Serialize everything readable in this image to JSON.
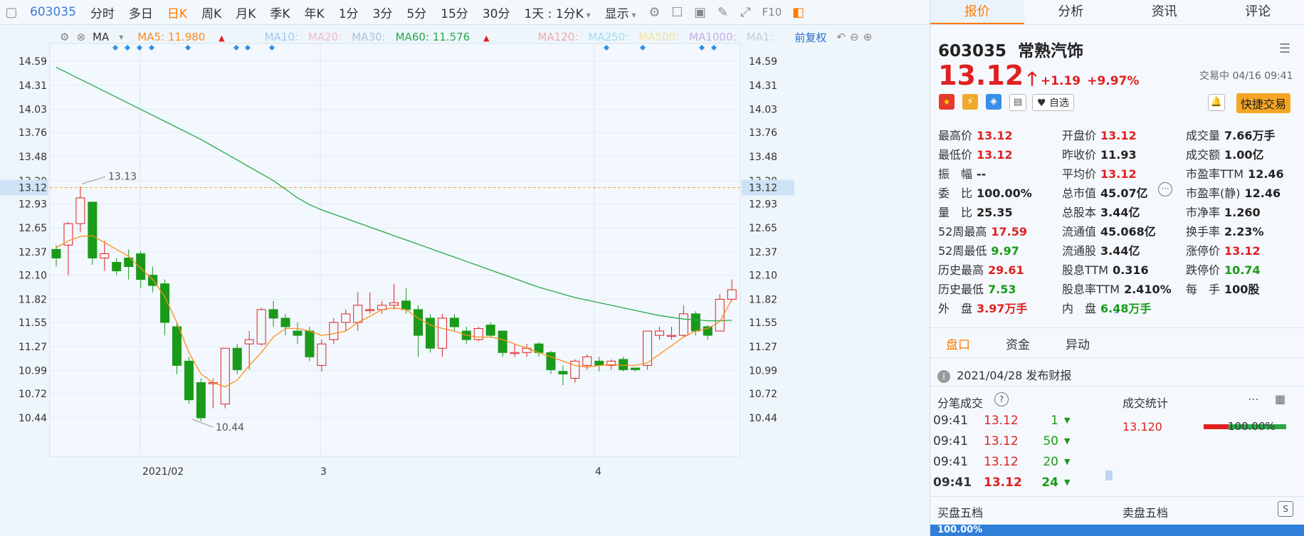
{
  "toolbar": {
    "code": "603035",
    "items": [
      "分时",
      "多日",
      "日K",
      "周K",
      "月K",
      "季K",
      "年K",
      "1分",
      "3分",
      "5分",
      "15分",
      "30分"
    ],
    "active": "日K",
    "period_select": "1天 : 1分K",
    "display": "显示",
    "f10": "F10"
  },
  "ma": {
    "label": "MA",
    "ma5": "MA5: 11.980",
    "ma10": "MA10:",
    "ma20": "MA20:",
    "ma30": "MA30:",
    "ma60": "MA60: 11.576",
    "ma120": "MA120:",
    "ma250": "MA250:",
    "ma500": "MA500:",
    "ma1000": "MA1000:",
    "ma1": "MA1:",
    "fq": "前复权"
  },
  "chart_data": {
    "type": "candlestick",
    "y_ticks": [
      "14.59",
      "14.31",
      "14.03",
      "13.76",
      "13.48",
      "13.20",
      "12.93",
      "12.65",
      "12.37",
      "12.10",
      "11.82",
      "11.55",
      "11.27",
      "10.99",
      "10.72",
      "10.44"
    ],
    "x_labels": [
      "2021/02",
      "3",
      "4"
    ],
    "current_price": "13.12",
    "high_label": "13.13",
    "low_label": "10.44",
    "candles": [
      [
        12.4,
        12.3,
        12.45,
        12.2
      ],
      [
        12.45,
        12.7,
        12.72,
        12.1
      ],
      [
        12.7,
        13.0,
        13.13,
        12.6
      ],
      [
        12.95,
        12.3,
        12.95,
        12.22
      ],
      [
        12.3,
        12.35,
        12.5,
        12.15
      ],
      [
        12.25,
        12.15,
        12.3,
        12.1
      ],
      [
        12.3,
        12.2,
        12.4,
        12.05
      ],
      [
        12.35,
        12.05,
        12.38,
        11.95
      ],
      [
        12.1,
        11.98,
        12.2,
        11.9
      ],
      [
        12.0,
        11.55,
        12.05,
        11.4
      ],
      [
        11.5,
        11.05,
        11.55,
        10.95
      ],
      [
        11.1,
        10.65,
        11.15,
        10.6
      ],
      [
        10.85,
        10.44,
        10.9,
        10.4
      ],
      [
        10.85,
        10.85,
        10.9,
        10.55
      ],
      [
        10.6,
        11.25,
        11.25,
        10.55
      ],
      [
        11.25,
        11.0,
        11.3,
        10.95
      ],
      [
        11.3,
        11.35,
        11.45,
        11.0
      ],
      [
        11.3,
        11.7,
        11.72,
        11.28
      ],
      [
        11.7,
        11.6,
        11.8,
        11.5
      ],
      [
        11.6,
        11.5,
        11.65,
        11.4
      ],
      [
        11.45,
        11.4,
        11.55,
        11.3
      ],
      [
        11.45,
        11.15,
        11.5,
        11.1
      ],
      [
        11.05,
        11.3,
        11.35,
        10.98
      ],
      [
        11.35,
        11.55,
        11.6,
        11.3
      ],
      [
        11.55,
        11.65,
        11.7,
        11.45
      ],
      [
        11.55,
        11.75,
        11.9,
        11.45
      ],
      [
        11.7,
        11.7,
        11.9,
        11.65
      ],
      [
        11.7,
        11.75,
        11.8,
        11.65
      ],
      [
        11.75,
        11.78,
        12.0,
        11.7
      ],
      [
        11.8,
        11.7,
        11.95,
        11.65
      ],
      [
        11.7,
        11.4,
        11.75,
        11.15
      ],
      [
        11.6,
        11.25,
        11.65,
        11.2
      ],
      [
        11.25,
        11.6,
        11.65,
        11.15
      ],
      [
        11.6,
        11.5,
        11.65,
        11.45
      ],
      [
        11.45,
        11.35,
        11.5,
        11.3
      ],
      [
        11.35,
        11.48,
        11.5,
        11.33
      ],
      [
        11.52,
        11.4,
        11.55,
        11.38
      ],
      [
        11.45,
        11.2,
        11.45,
        11.15
      ],
      [
        11.2,
        11.2,
        11.3,
        11.15
      ],
      [
        11.2,
        11.25,
        11.3,
        11.15
      ],
      [
        11.3,
        11.2,
        11.32,
        11.15
      ],
      [
        11.2,
        11.0,
        11.22,
        10.95
      ],
      [
        10.98,
        10.95,
        11.05,
        10.82
      ],
      [
        10.9,
        11.1,
        11.12,
        10.85
      ],
      [
        11.05,
        11.15,
        11.18,
        11.0
      ],
      [
        11.1,
        11.05,
        11.15,
        10.98
      ],
      [
        11.05,
        11.1,
        11.12,
        11.0
      ],
      [
        11.12,
        11.0,
        11.15,
        10.98
      ],
      [
        11.02,
        11.0,
        11.02,
        10.98
      ],
      [
        11.05,
        11.45,
        11.45,
        11.0
      ],
      [
        11.4,
        11.45,
        11.5,
        11.35
      ],
      [
        11.4,
        11.4,
        11.5,
        11.35
      ],
      [
        11.4,
        11.65,
        11.75,
        11.38
      ],
      [
        11.65,
        11.45,
        11.68,
        11.4
      ],
      [
        11.5,
        11.4,
        11.52,
        11.35
      ],
      [
        11.45,
        11.82,
        11.88,
        11.45
      ],
      [
        11.82,
        11.93,
        12.05,
        11.8
      ]
    ],
    "ma5": [
      12.42,
      12.5,
      12.55,
      12.56,
      12.48,
      12.4,
      12.32,
      12.18,
      12.05,
      11.85,
      11.55,
      11.2,
      10.95,
      10.85,
      10.8,
      10.88,
      11.05,
      11.2,
      11.38,
      11.48,
      11.48,
      11.45,
      11.4,
      11.42,
      11.45,
      11.55,
      11.62,
      11.7,
      11.72,
      11.7,
      11.6,
      11.52,
      11.48,
      11.45,
      11.4,
      11.38,
      11.38,
      11.35,
      11.3,
      11.25,
      11.2,
      11.15,
      11.1,
      11.05,
      11.03,
      11.05,
      11.06,
      11.05,
      11.05,
      11.08,
      11.18,
      11.28,
      11.38,
      11.45,
      11.48,
      11.56,
      11.82
    ],
    "ma60": [
      14.52,
      14.45,
      14.38,
      14.31,
      14.24,
      14.17,
      14.1,
      14.03,
      13.96,
      13.89,
      13.82,
      13.75,
      13.68,
      13.6,
      13.52,
      13.44,
      13.36,
      13.28,
      13.2,
      13.1,
      13.0,
      12.92,
      12.86,
      12.81,
      12.76,
      12.71,
      12.66,
      12.61,
      12.56,
      12.51,
      12.46,
      12.41,
      12.36,
      12.31,
      12.26,
      12.21,
      12.16,
      12.11,
      12.06,
      12.01,
      11.96,
      11.92,
      11.88,
      11.84,
      11.81,
      11.78,
      11.75,
      11.72,
      11.69,
      11.66,
      11.63,
      11.61,
      11.59,
      11.58,
      11.57,
      11.57,
      11.576
    ]
  },
  "quote": {
    "code": "603035",
    "name": "常熟汽饰",
    "price": "13.12",
    "change": "+1.19",
    "change_pct": "+9.97%",
    "status": "交易中 04/16 09:41",
    "zixuan": "自选",
    "quick_trade": "快捷交易",
    "fields": [
      [
        {
          "l": "最高价",
          "v": "13.12",
          "c": "red"
        },
        {
          "l": "开盘价",
          "v": "13.12",
          "c": "red"
        },
        {
          "l": "成交量",
          "v": "7.66万手",
          "c": "dark"
        }
      ],
      [
        {
          "l": "最低价",
          "v": "13.12",
          "c": "red"
        },
        {
          "l": "昨收价",
          "v": "11.93",
          "c": "dark"
        },
        {
          "l": "成交额",
          "v": "1.00亿",
          "c": "dark"
        }
      ],
      [
        {
          "l": "振　幅",
          "v": "--",
          "c": "dark"
        },
        {
          "l": "平均价",
          "v": "13.12",
          "c": "red"
        },
        {
          "l": "市盈率TTM",
          "v": "12.46",
          "c": "dark"
        }
      ],
      [
        {
          "l": "委　比",
          "v": "100.00%",
          "c": "dark"
        },
        {
          "l": "总市值",
          "v": "45.07亿",
          "c": "dark"
        },
        {
          "l": "市盈率(静)",
          "v": "12.46",
          "c": "dark"
        }
      ],
      [
        {
          "l": "量　比",
          "v": "25.35",
          "c": "dark"
        },
        {
          "l": "总股本",
          "v": "3.44亿",
          "c": "dark"
        },
        {
          "l": "市净率",
          "v": "1.260",
          "c": "dark"
        }
      ],
      [
        {
          "l": "52周最高",
          "v": "17.59",
          "c": "red"
        },
        {
          "l": "流通值",
          "v": "45.068亿",
          "c": "dark"
        },
        {
          "l": "换手率",
          "v": "2.23%",
          "c": "dark"
        }
      ],
      [
        {
          "l": "52周最低",
          "v": "9.97",
          "c": "green"
        },
        {
          "l": "流通股",
          "v": "3.44亿",
          "c": "dark"
        },
        {
          "l": "涨停价",
          "v": "13.12",
          "c": "red"
        }
      ],
      [
        {
          "l": "历史最高",
          "v": "29.61",
          "c": "red"
        },
        {
          "l": "股息TTM",
          "v": "0.316",
          "c": "dark"
        },
        {
          "l": "跌停价",
          "v": "10.74",
          "c": "green"
        }
      ],
      [
        {
          "l": "历史最低",
          "v": "7.53",
          "c": "green"
        },
        {
          "l": "股息率TTM",
          "v": "2.410%",
          "c": "dark"
        },
        {
          "l": "每　手",
          "v": "100股",
          "c": "dark"
        }
      ],
      [
        {
          "l": "外　盘",
          "v": "3.97万手",
          "c": "red"
        },
        {
          "l": "内　盘",
          "v": "6.48万手",
          "c": "green"
        },
        {
          "l": "",
          "v": "",
          "c": "dark"
        }
      ]
    ]
  },
  "tabs": [
    "报价",
    "分析",
    "资讯",
    "评论"
  ],
  "subtabs": [
    "盘口",
    "资金",
    "异动"
  ],
  "notice": "2021/04/28  发布财报",
  "ticks_title": "分笔成交",
  "stats_title": "成交统计",
  "ticks": [
    {
      "t": "09:41",
      "p": "13.12",
      "v": "1"
    },
    {
      "t": "09:41",
      "p": "13.12",
      "v": "50"
    },
    {
      "t": "09:41",
      "p": "13.12",
      "v": "20"
    },
    {
      "t": "09:41",
      "p": "13.12",
      "v": "24"
    }
  ],
  "stats_price": "13.120",
  "stats_pct": "100.00%",
  "bid_title": "买盘五档",
  "ask_title": "卖盘五档",
  "bottom_pct": "100.00%"
}
